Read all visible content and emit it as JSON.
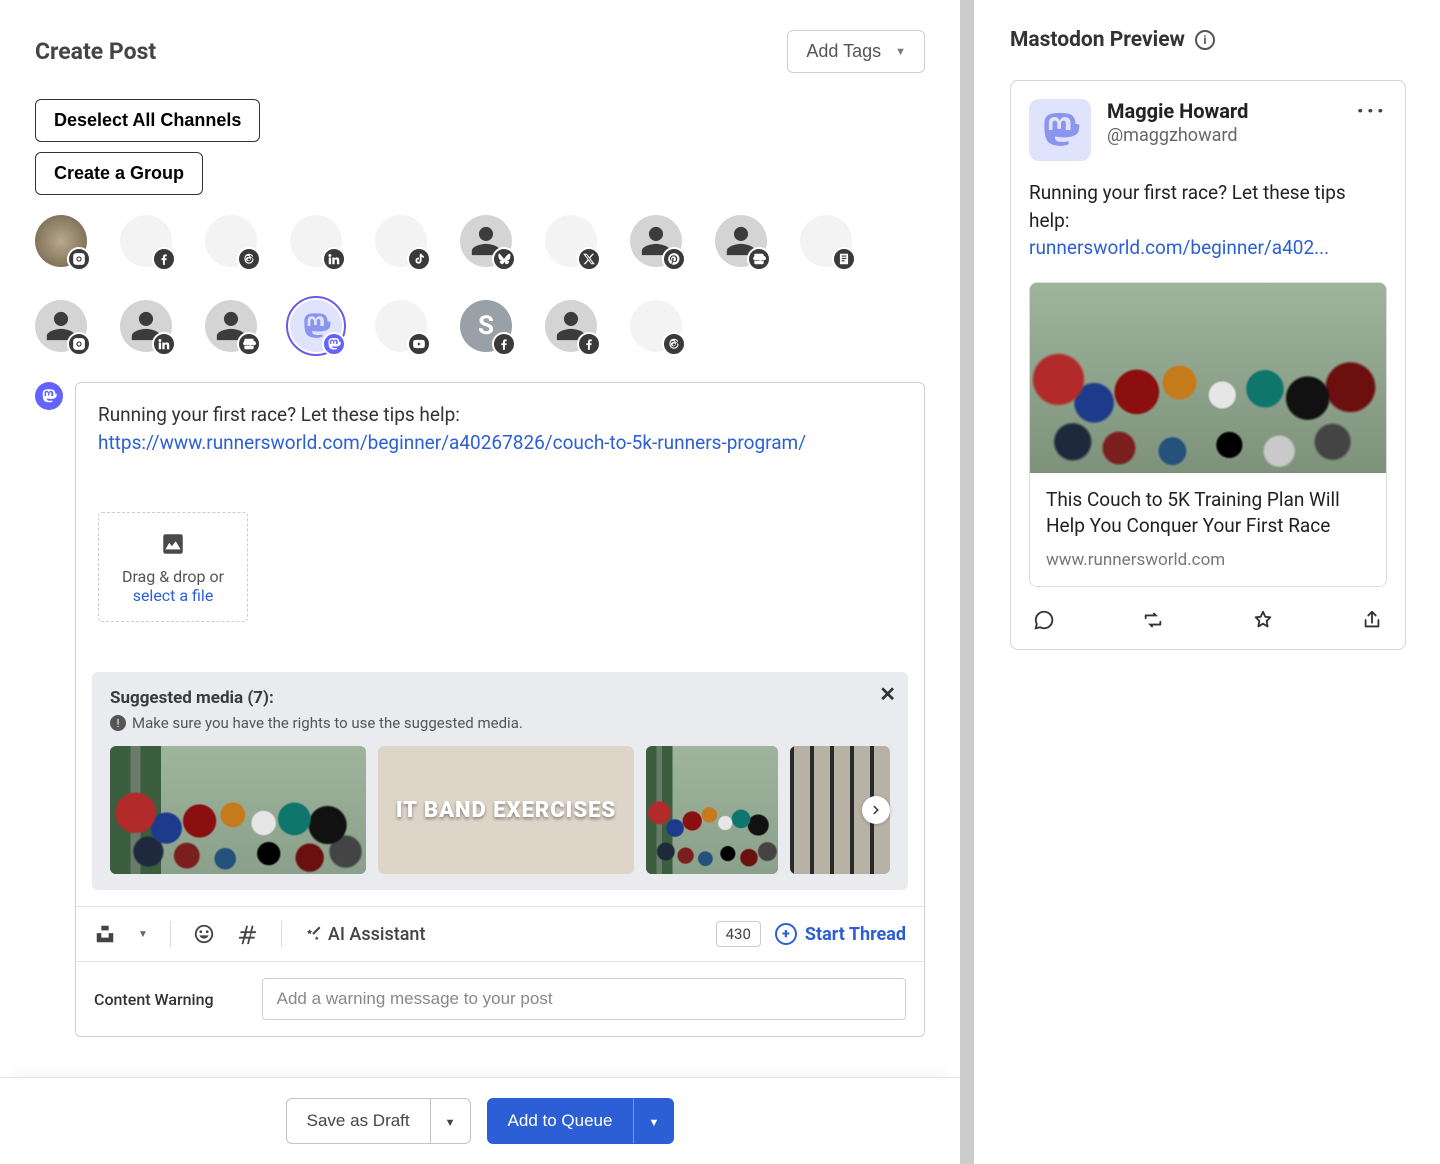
{
  "header": {
    "title": "Create Post",
    "add_tags": "Add Tags"
  },
  "channel_buttons": {
    "deselect": "Deselect All Channels",
    "create_group": "Create a Group"
  },
  "channels": {
    "row1": [
      {
        "name": "instagram",
        "avatar": "photo"
      },
      {
        "name": "facebook",
        "avatar": "soft"
      },
      {
        "name": "threads",
        "avatar": "soft"
      },
      {
        "name": "linkedin",
        "avatar": "soft"
      },
      {
        "name": "tiktok",
        "avatar": "soft"
      },
      {
        "name": "bluesky",
        "avatar": "person"
      },
      {
        "name": "x",
        "avatar": "soft"
      },
      {
        "name": "pinterest",
        "avatar": "person"
      },
      {
        "name": "google-business",
        "avatar": "person"
      },
      {
        "name": "start-page",
        "avatar": "soft"
      }
    ],
    "row2": [
      {
        "name": "instagram",
        "avatar": "person"
      },
      {
        "name": "linkedin",
        "avatar": "person"
      },
      {
        "name": "google-business",
        "avatar": "person"
      },
      {
        "name": "mastodon",
        "avatar": "mast",
        "selected": true
      },
      {
        "name": "youtube",
        "avatar": "soft"
      },
      {
        "name": "facebook",
        "avatar": "s-letter"
      },
      {
        "name": "facebook",
        "avatar": "person"
      },
      {
        "name": "threads",
        "avatar": "soft"
      }
    ]
  },
  "composer": {
    "text": "Running your first race? Let these tips help:",
    "link_url": "https://www.runnersworld.com/beginner/a40267826/couch-to-5k-runners-program/",
    "dropzone": {
      "text1": "Drag & drop or ",
      "link": "select a file"
    }
  },
  "suggested": {
    "title": "Suggested media (7):",
    "note": "Make sure you have the rights to use the suggested media.",
    "thumb2_label": "IT BAND EXERCISES"
  },
  "toolbar": {
    "ai": "AI Assistant",
    "count": "430",
    "start_thread": "Start Thread"
  },
  "content_warning": {
    "label": "Content Warning",
    "placeholder": "Add a warning message to your post"
  },
  "footer": {
    "draft": "Save as Draft",
    "queue": "Add to Queue"
  },
  "preview": {
    "heading": "Mastodon Preview",
    "name": "Maggie Howard",
    "handle": "@maggzhoward",
    "text": "Running your first race? Let these tips help:",
    "link_short": "runnersworld.com/beginner/a402...",
    "card_title": "This Couch to 5K Training Plan Will Help You Conquer Your First Race",
    "card_domain": "www.runnersworld.com"
  }
}
